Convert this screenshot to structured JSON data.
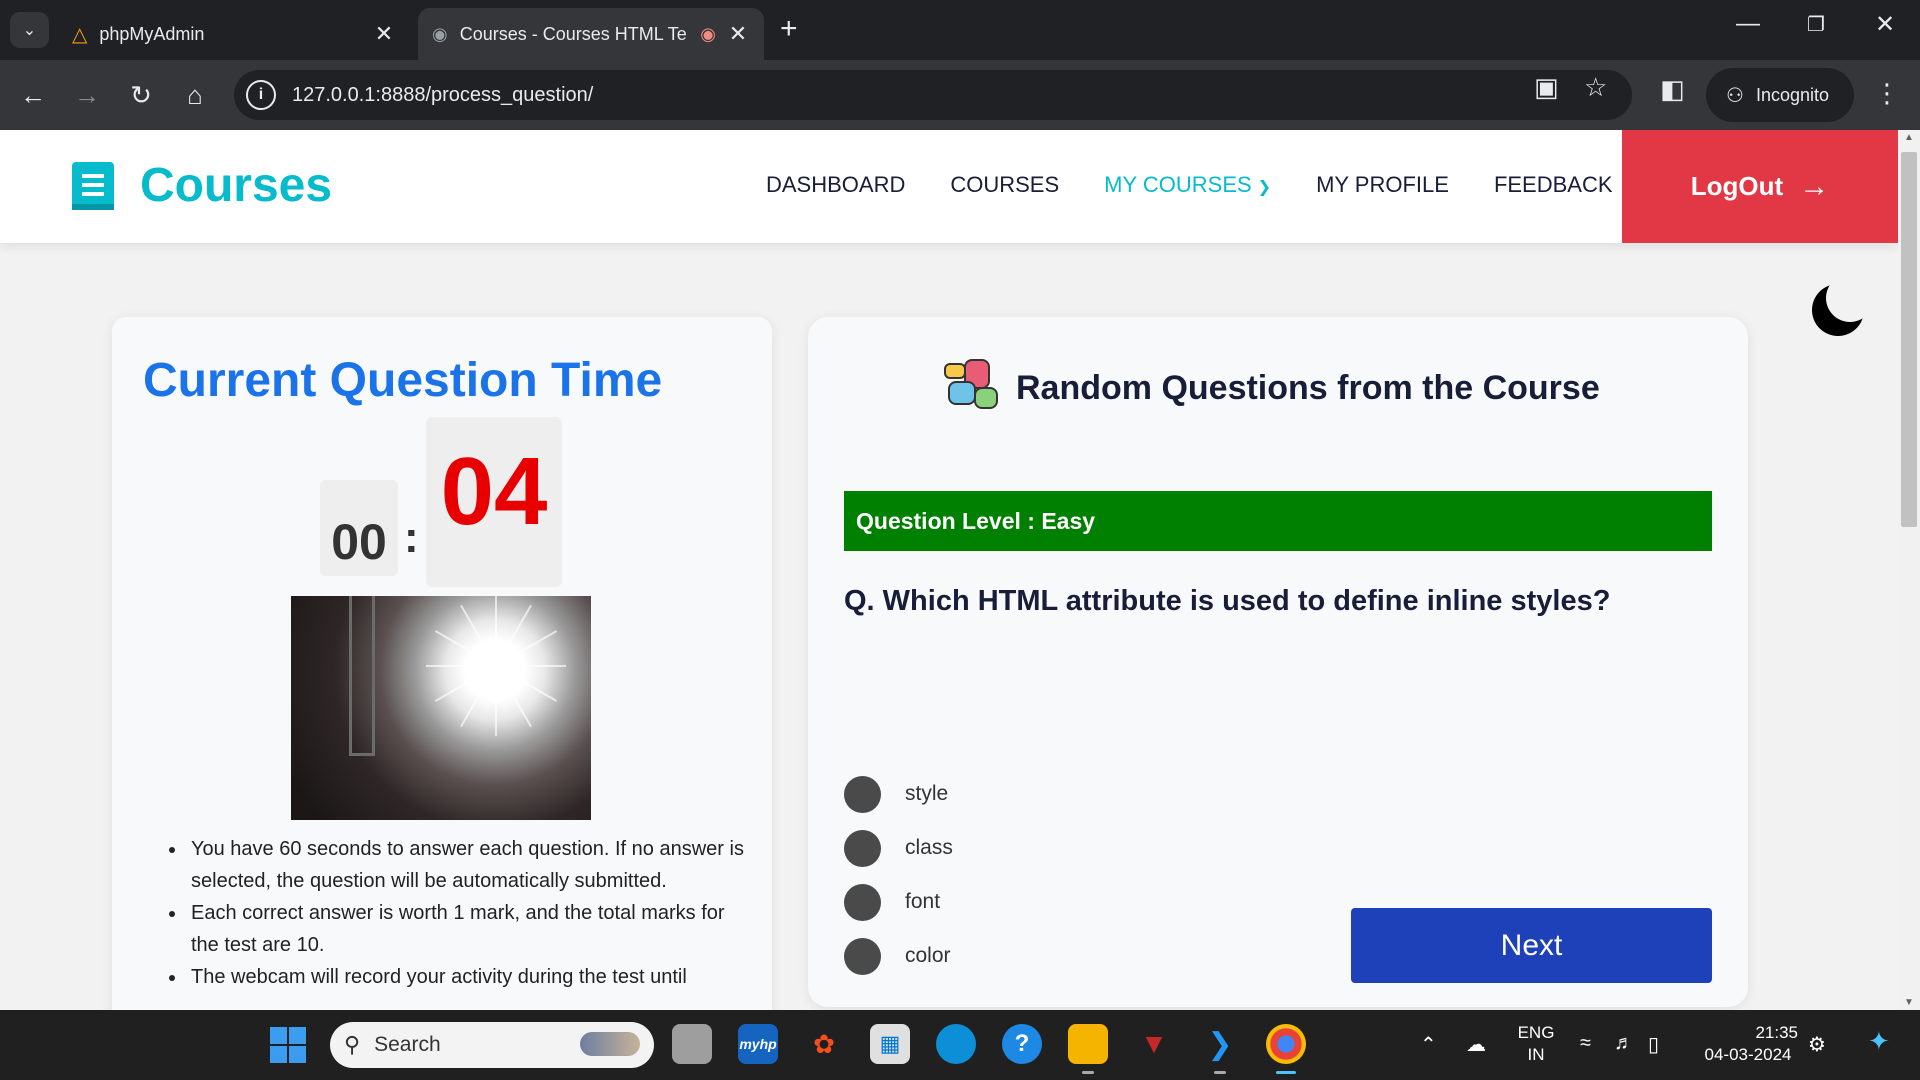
{
  "browser": {
    "tabs": [
      {
        "title": "phpMyAdmin",
        "active": false,
        "icon": "phpmyadmin-icon"
      },
      {
        "title": "Courses - Courses HTML Te",
        "active": true,
        "icon": "globe-icon",
        "recording": true
      }
    ],
    "url": "127.0.0.1:8888/process_question/",
    "incognito_label": "Incognito"
  },
  "site": {
    "brand": "Courses",
    "nav": [
      {
        "label": "DASHBOARD",
        "active": false
      },
      {
        "label": "COURSES",
        "active": false
      },
      {
        "label": "MY COURSES",
        "active": true,
        "has_dropdown": true
      },
      {
        "label": "MY PROFILE",
        "active": false
      },
      {
        "label": "FEEDBACK",
        "active": false
      }
    ],
    "logout_label": "LogOut",
    "colors": {
      "brand": "#06bbcc",
      "logout": "#e23744",
      "timer_title": "#1a73e8",
      "seconds": "#e80000",
      "level_bar": "#008000",
      "next_button": "#1e40b8"
    }
  },
  "timer": {
    "title": "Current Question Time",
    "minutes": "00",
    "separator": ":",
    "seconds": "04",
    "rules": [
      "You have 60 seconds to answer each question. If no answer is selected, the question will be automatically submitted.",
      "Each correct answer is worth 1 mark, and the total marks for the test are 10.",
      "The webcam will record your activity during the test until"
    ]
  },
  "quiz": {
    "heading": "Random Questions from the Course",
    "level_text": "Question Level : Easy",
    "question": "Q. Which HTML attribute is used to define inline styles?",
    "options": [
      "style",
      "class",
      "font",
      "color"
    ],
    "next_label": "Next"
  },
  "taskbar": {
    "search_placeholder": "Search",
    "language": {
      "line1": "ENG",
      "line2": "IN"
    },
    "time": "21:35",
    "date": "04-03-2024",
    "myhp_label": "myhp"
  }
}
